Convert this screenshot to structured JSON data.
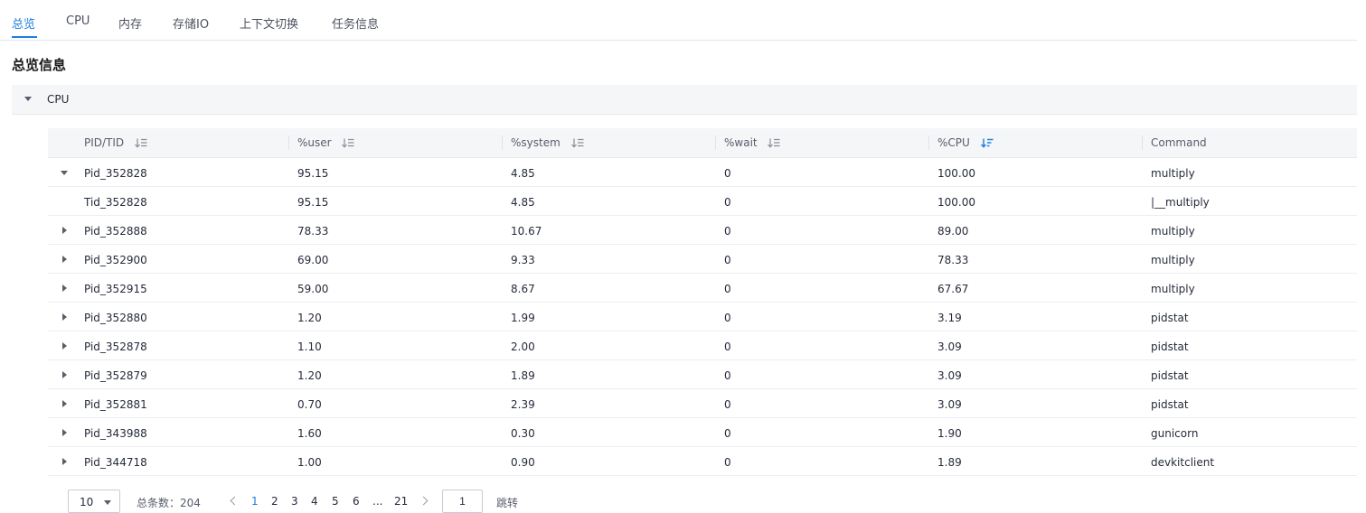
{
  "tabs": [
    {
      "label": "总览",
      "active": true
    },
    {
      "label": "CPU",
      "active": false
    },
    {
      "label": "内存",
      "active": false
    },
    {
      "label": "存储IO",
      "active": false
    },
    {
      "label": "上下文切换",
      "active": false
    },
    {
      "label": "任务信息",
      "active": false
    }
  ],
  "section_title": "总览信息",
  "panel": {
    "label": "CPU",
    "expanded": true
  },
  "table": {
    "columns": [
      {
        "label": "PID/TID",
        "sort": "none"
      },
      {
        "label": "%user",
        "sort": "none"
      },
      {
        "label": "%system",
        "sort": "none"
      },
      {
        "label": "%wait",
        "sort": "none"
      },
      {
        "label": "%CPU",
        "sort": "desc-active"
      },
      {
        "label": "Command",
        "sort": ""
      }
    ],
    "rows": [
      {
        "id": "Pid_352828",
        "user": "95.15",
        "system": "4.85",
        "wait": "0",
        "cpu": "100.00",
        "command": "multiply",
        "expander": "expanded"
      },
      {
        "id": "Tid_352828",
        "user": "95.15",
        "system": "4.85",
        "wait": "0",
        "cpu": "100.00",
        "command": "|__multiply",
        "expander": "none"
      },
      {
        "id": "Pid_352888",
        "user": "78.33",
        "system": "10.67",
        "wait": "0",
        "cpu": "89.00",
        "command": "multiply",
        "expander": "collapsed"
      },
      {
        "id": "Pid_352900",
        "user": "69.00",
        "system": "9.33",
        "wait": "0",
        "cpu": "78.33",
        "command": "multiply",
        "expander": "collapsed"
      },
      {
        "id": "Pid_352915",
        "user": "59.00",
        "system": "8.67",
        "wait": "0",
        "cpu": "67.67",
        "command": "multiply",
        "expander": "collapsed"
      },
      {
        "id": "Pid_352880",
        "user": "1.20",
        "system": "1.99",
        "wait": "0",
        "cpu": "3.19",
        "command": "pidstat",
        "expander": "collapsed"
      },
      {
        "id": "Pid_352878",
        "user": "1.10",
        "system": "2.00",
        "wait": "0",
        "cpu": "3.09",
        "command": "pidstat",
        "expander": "collapsed"
      },
      {
        "id": "Pid_352879",
        "user": "1.20",
        "system": "1.89",
        "wait": "0",
        "cpu": "3.09",
        "command": "pidstat",
        "expander": "collapsed"
      },
      {
        "id": "Pid_352881",
        "user": "0.70",
        "system": "2.39",
        "wait": "0",
        "cpu": "3.09",
        "command": "pidstat",
        "expander": "collapsed"
      },
      {
        "id": "Pid_343988",
        "user": "1.60",
        "system": "0.30",
        "wait": "0",
        "cpu": "1.90",
        "command": "gunicorn",
        "expander": "collapsed"
      },
      {
        "id": "Pid_344718",
        "user": "1.00",
        "system": "0.90",
        "wait": "0",
        "cpu": "1.89",
        "command": "devkitclient",
        "expander": "collapsed"
      }
    ]
  },
  "pagination": {
    "page_size": "10",
    "total_label": "总条数：204",
    "pages": [
      "1",
      "2",
      "3",
      "4",
      "5",
      "6",
      "...",
      "21"
    ],
    "current_page": "1",
    "jump_value": "1",
    "jump_label": "跳转"
  },
  "colors": {
    "accent": "#1e7ee0",
    "header_bg": "#f5f6f8",
    "text": "#252b3a"
  }
}
